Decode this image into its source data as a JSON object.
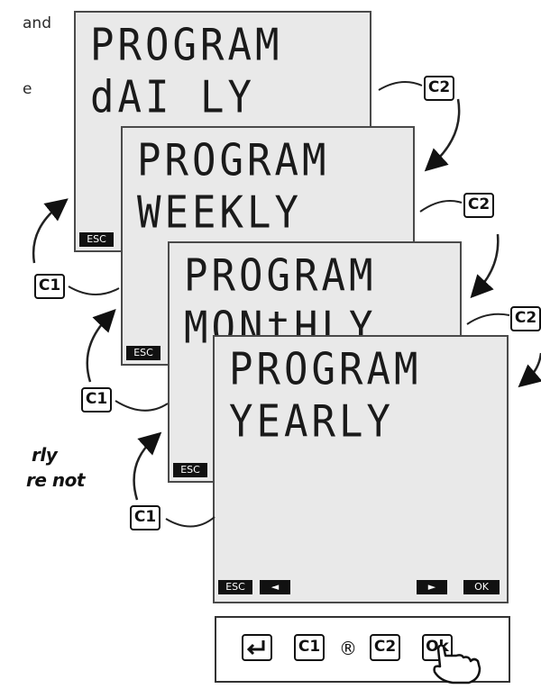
{
  "side_text": [
    "and",
    "e",
    "rly",
    "re not"
  ],
  "screens": [
    {
      "line1": "PROGRAM",
      "line2": "dAI LY",
      "esc": "ESC"
    },
    {
      "line1": "PROGRAM",
      "line2": "WEEKLY",
      "esc": "ESC"
    },
    {
      "line1": "PROGRAM",
      "line2": "MONtHLY",
      "esc": "ESC"
    },
    {
      "line1": "PROGRAM",
      "line2": "YEARLY",
      "esc": "ESC",
      "left_arrow": "◄",
      "right_arrow": "►",
      "ok": "OK"
    }
  ],
  "key_labels": {
    "c1": "C1",
    "c2": "C2"
  },
  "button_bar": {
    "enter_icon": "enter-icon",
    "c1": "C1",
    "registered": "®",
    "c2": "C2",
    "ok": "Ok"
  }
}
